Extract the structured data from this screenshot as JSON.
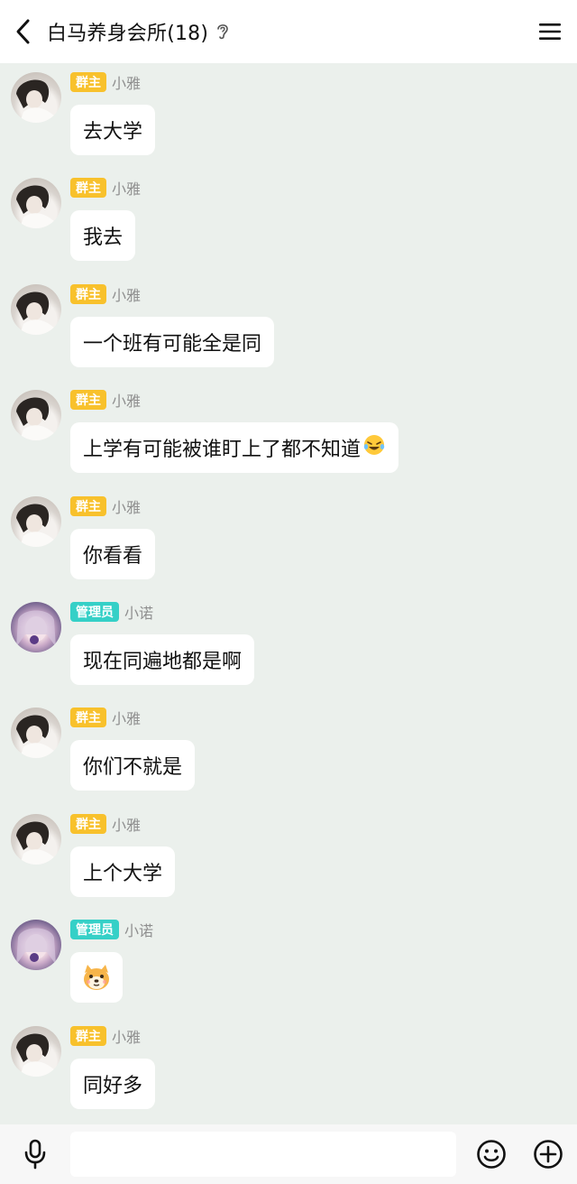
{
  "header": {
    "title": "白马养身会所(18)"
  },
  "messages": [
    {
      "role": "群主",
      "name": "小雅",
      "text": "去大学",
      "avatar": "girl-avatar",
      "roleType": "owner"
    },
    {
      "role": "群主",
      "name": "小雅",
      "text": "我去",
      "avatar": "girl-avatar",
      "roleType": "owner"
    },
    {
      "role": "群主",
      "name": "小雅",
      "text": "一个班有可能全是同",
      "avatar": "girl-avatar",
      "roleType": "owner"
    },
    {
      "role": "群主",
      "name": "小雅",
      "text": "上学有可能被谁盯上了都不知道",
      "avatar": "girl-avatar",
      "roleType": "owner",
      "trailingEmoji": "laughing-tear-emoji"
    },
    {
      "role": "群主",
      "name": "小雅",
      "text": "你看看",
      "avatar": "girl-avatar",
      "roleType": "owner"
    },
    {
      "role": "管理员",
      "name": "小诺",
      "text": "现在同遍地都是啊",
      "avatar": "anime-avatar",
      "roleType": "admin"
    },
    {
      "role": "群主",
      "name": "小雅",
      "text": "你们不就是",
      "avatar": "girl-avatar",
      "roleType": "owner"
    },
    {
      "role": "群主",
      "name": "小雅",
      "text": "上个大学",
      "avatar": "girl-avatar",
      "roleType": "owner"
    },
    {
      "role": "管理员",
      "name": "小诺",
      "text": "",
      "avatar": "anime-avatar",
      "roleType": "admin",
      "sticker": "dog-face-emoji"
    },
    {
      "role": "群主",
      "name": "小雅",
      "text": "同好多",
      "avatar": "girl-avatar",
      "roleType": "owner"
    }
  ],
  "colors": {
    "owner_badge": "#f8c12c",
    "admin_badge": "#35d0c7",
    "chat_bg": "#ebf0ec"
  },
  "input": {
    "value": "",
    "placeholder": ""
  }
}
